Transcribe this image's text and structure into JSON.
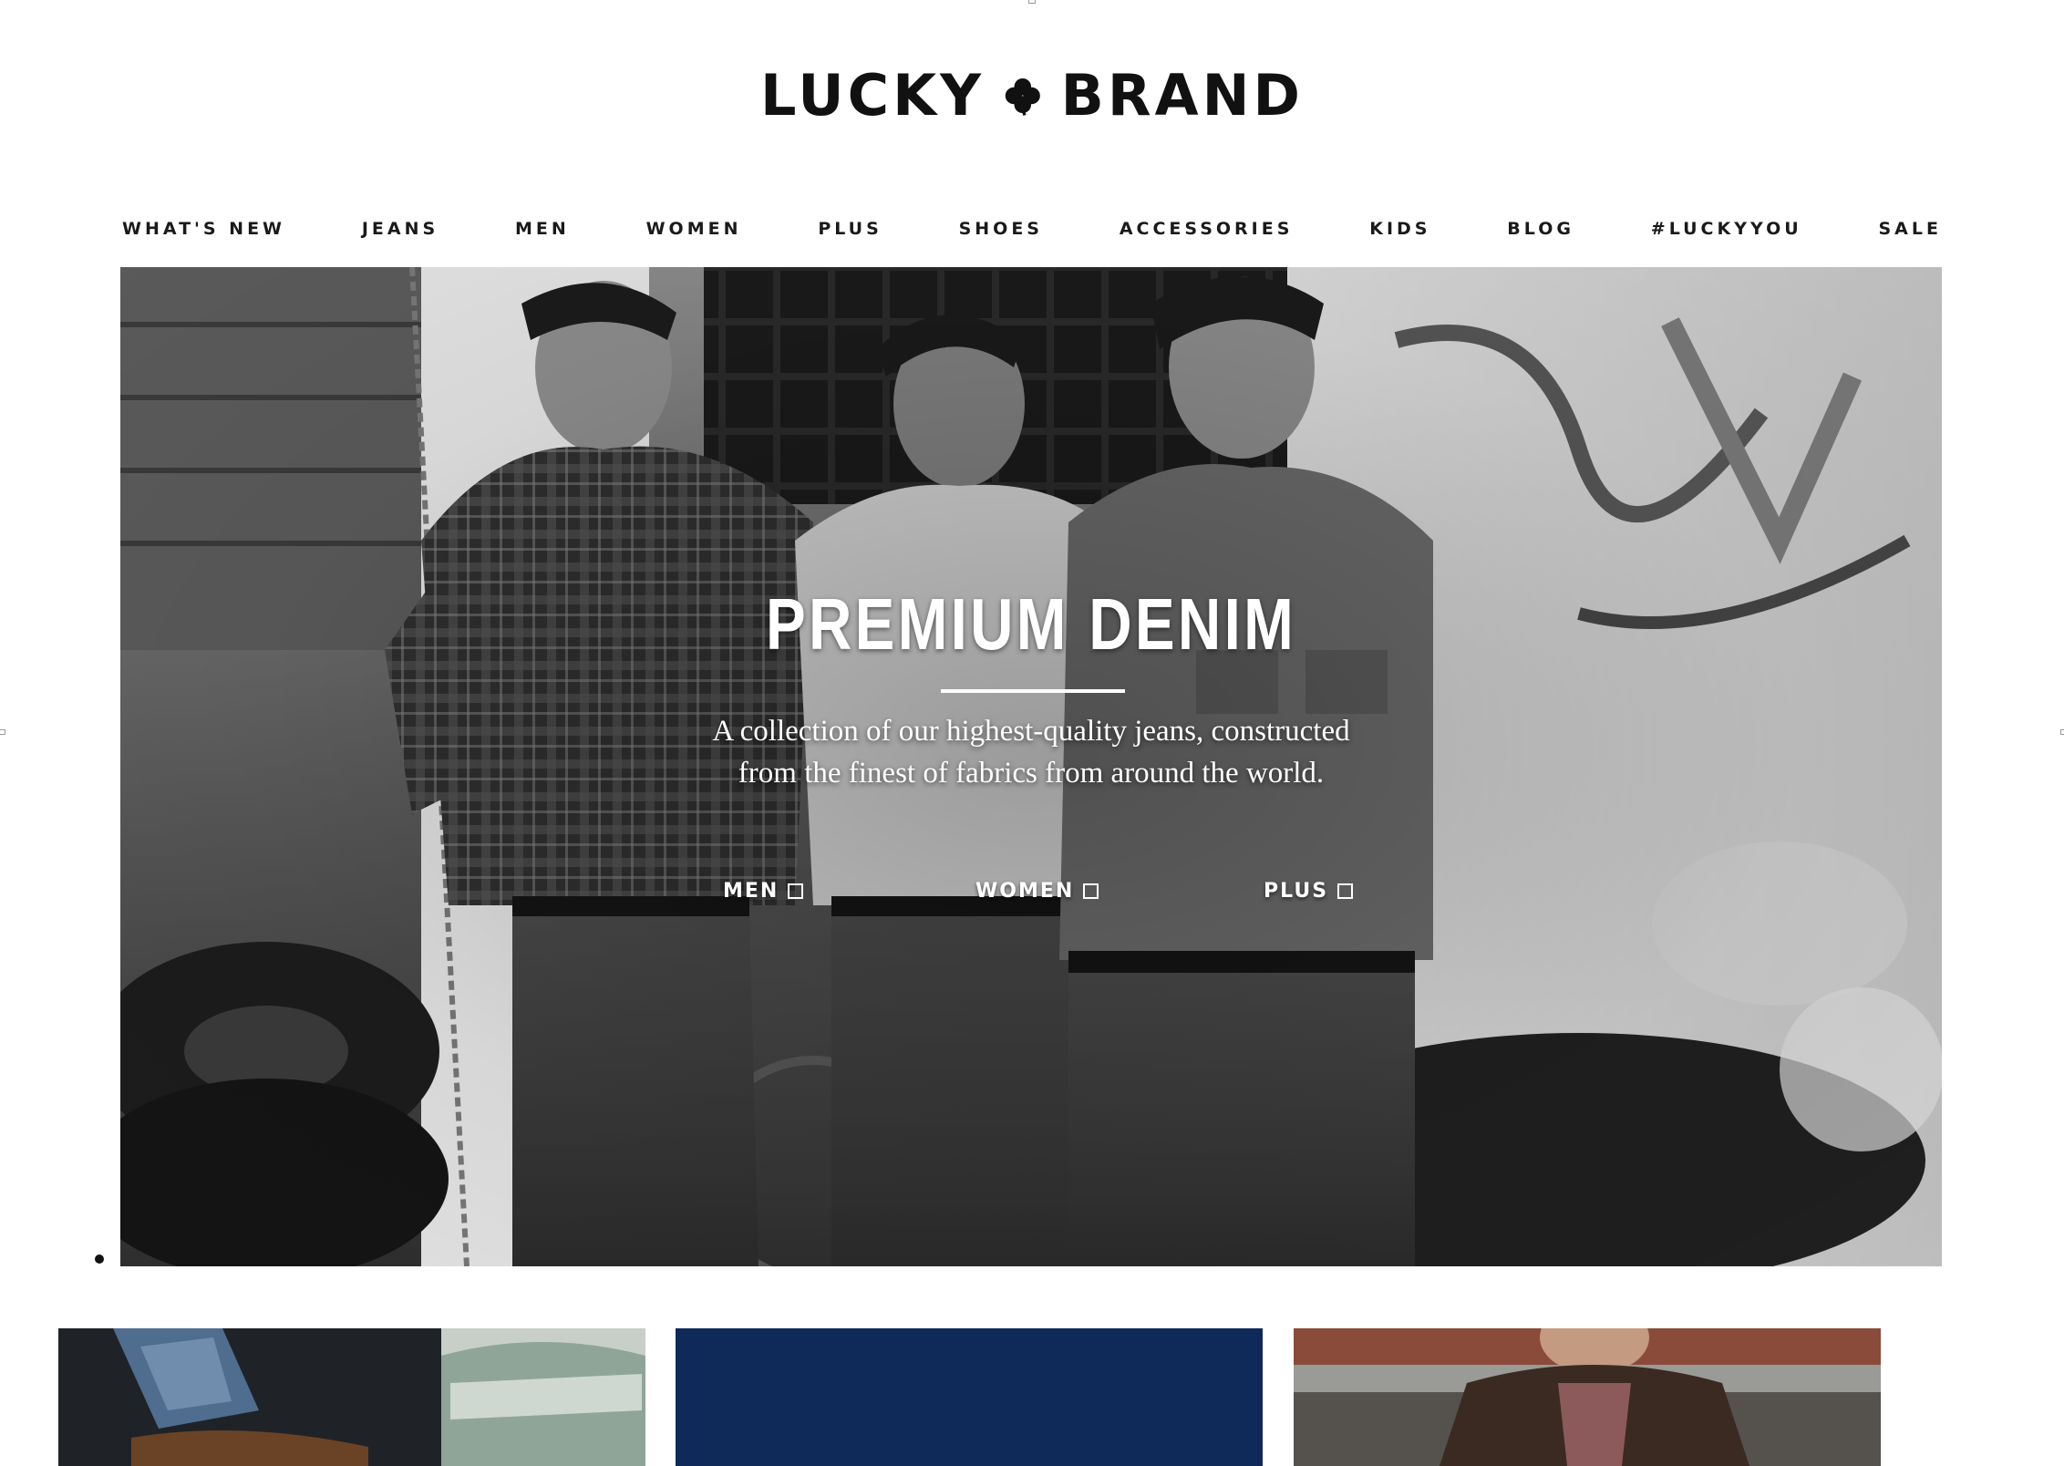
{
  "brand": {
    "logo_left": "LUCKY",
    "logo_right": "BRAND",
    "logo_icon": "clover-icon"
  },
  "nav": {
    "items": [
      {
        "label": "WHAT'S NEW"
      },
      {
        "label": "JEANS"
      },
      {
        "label": "MEN"
      },
      {
        "label": "WOMEN"
      },
      {
        "label": "PLUS"
      },
      {
        "label": "SHOES"
      },
      {
        "label": "ACCESSORIES"
      },
      {
        "label": "KIDS"
      },
      {
        "label": "BLOG"
      },
      {
        "label": "#LUCKYYOU"
      },
      {
        "label": "SALE"
      }
    ]
  },
  "hero": {
    "title": "PREMIUM DENIM",
    "description_line1": "A collection of our highest-quality jeans, constructed",
    "description_line2": "from the finest of fabrics from around the world.",
    "links": [
      {
        "label": "MEN",
        "icon": "square-icon"
      },
      {
        "label": "WOMEN",
        "icon": "square-icon"
      },
      {
        "label": "PLUS",
        "icon": "square-icon"
      }
    ],
    "image": "black-and-white photo of three men in denim leaning against a motorcycle"
  },
  "carousel": {
    "active_index": 1,
    "count": 1
  },
  "tiles": [
    {
      "kind": "photo"
    },
    {
      "kind": "solid",
      "color": "#0f2a59"
    },
    {
      "kind": "photo"
    }
  ]
}
